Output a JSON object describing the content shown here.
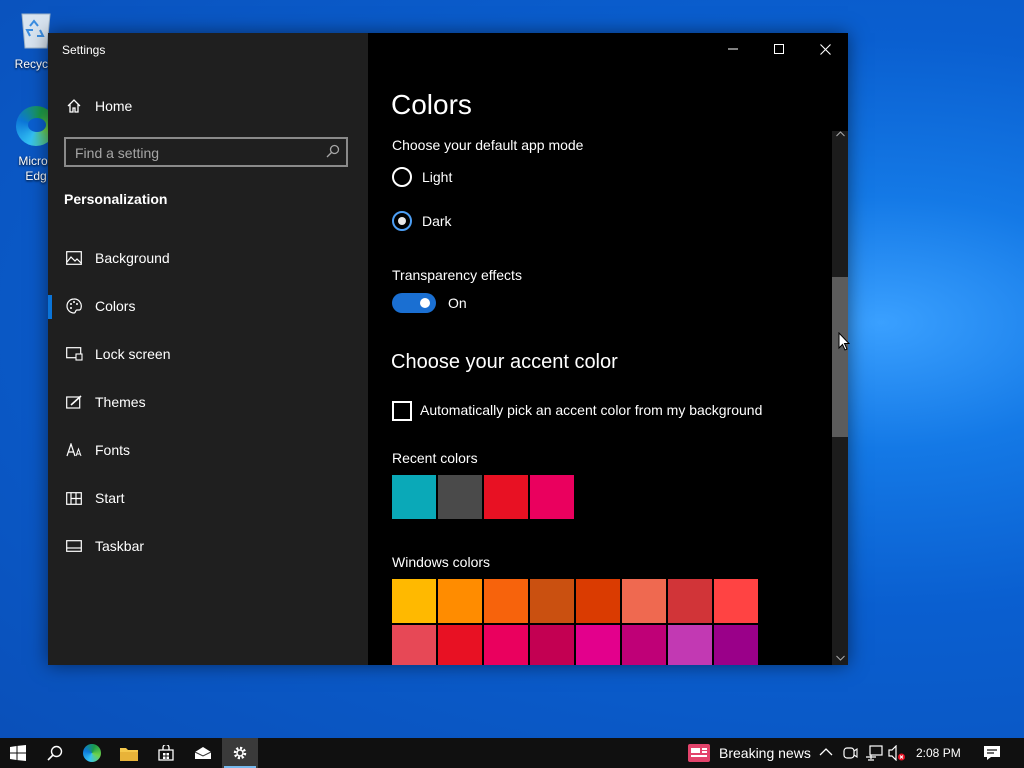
{
  "desktop": {
    "icons": [
      {
        "label": "Recycle",
        "icon": "recycle-bin-icon"
      },
      {
        "label": "Micros",
        "label2": "Edg",
        "icon": "edge-icon"
      }
    ]
  },
  "window": {
    "title": "Settings",
    "caption_buttons": [
      "minimize-icon",
      "maximize-icon",
      "close-icon"
    ]
  },
  "sidebar": {
    "home_label": "Home",
    "search_placeholder": "Find a setting",
    "section_title": "Personalization",
    "selected": "Colors",
    "items": [
      {
        "label": "Background",
        "icon": "picture-icon"
      },
      {
        "label": "Colors",
        "icon": "palette-icon"
      },
      {
        "label": "Lock screen",
        "icon": "lock-screen-icon"
      },
      {
        "label": "Themes",
        "icon": "themes-brush-icon"
      },
      {
        "label": "Fonts",
        "icon": "fonts-icon"
      },
      {
        "label": "Start",
        "icon": "start-grid-icon"
      },
      {
        "label": "Taskbar",
        "icon": "taskbar-icon"
      }
    ]
  },
  "content": {
    "title": "Colors",
    "app_mode_label": "Choose your default app mode",
    "app_mode_options": [
      {
        "label": "Light",
        "checked": false
      },
      {
        "label": "Dark",
        "checked": true
      }
    ],
    "transparency_label": "Transparency effects",
    "transparency_state": "On",
    "accent_heading": "Choose your accent color",
    "auto_pick_label": "Automatically pick an accent color from my background",
    "auto_pick_checked": false,
    "recent_label": "Recent colors",
    "recent_colors": [
      "#0aa9b8",
      "#4a4a4a",
      "#e81123",
      "#ea005e"
    ],
    "windows_label": "Windows colors",
    "windows_colors_row1": [
      "#ffb900",
      "#ff8c00",
      "#f7630c",
      "#ca5010",
      "#da3b01",
      "#ef6950",
      "#d13438",
      "#ff4343"
    ],
    "windows_colors_row2": [
      "#e74856",
      "#e81123",
      "#ea005e",
      "#c30052",
      "#e3008c",
      "#bf0077",
      "#c239b3",
      "#9a0089"
    ]
  },
  "taskbar": {
    "apps": [
      "start-windows-icon",
      "search-icon",
      "edge-icon",
      "file-explorer-icon",
      "store-icon",
      "mail-icon",
      "settings-gear-icon"
    ],
    "news_label": "Breaking news",
    "time": "2:08 PM"
  },
  "colors": {
    "accent": "#0a74d8",
    "sidebar_bg": "#1f1f1f",
    "content_bg": "#000000"
  }
}
